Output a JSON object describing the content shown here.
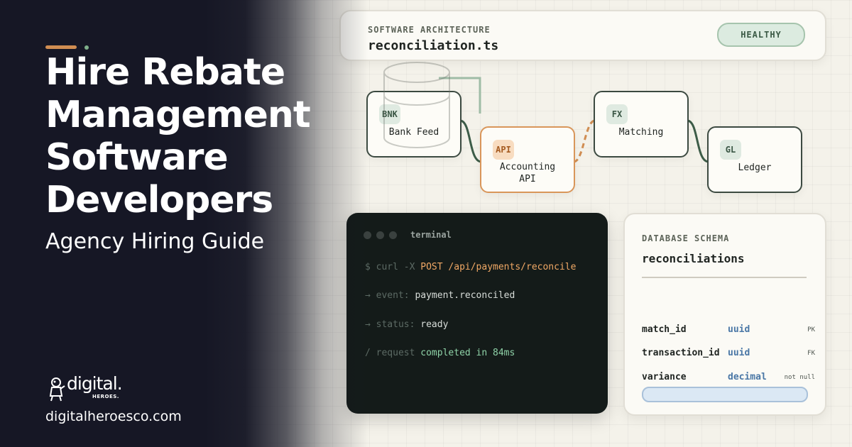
{
  "hero": {
    "headline": [
      "Hire Rebate",
      "Management",
      "Software",
      "Developers"
    ],
    "subtitle": "Agency Hiring Guide",
    "brand_word": "digital.",
    "brand_sub": "HEROES.",
    "site": "digitalheroesco.com"
  },
  "architecture": {
    "label": "SOFTWARE ARCHITECTURE",
    "file": "reconciliation.ts",
    "status": "HEALTHY",
    "nodes": [
      {
        "tag": "BNK",
        "title": "Bank Feed"
      },
      {
        "tag": "API",
        "title": "Accounting\nAPI"
      },
      {
        "tag": "FX",
        "title": "Matching"
      },
      {
        "tag": "GL",
        "title": "Ledger"
      }
    ]
  },
  "terminal": {
    "title": "terminal",
    "prompt": "$",
    "command_word": "curl -X",
    "command_rest": "POST /api/payments/reconcile",
    "lines": [
      {
        "prefix": "→",
        "key": "event:",
        "value": "payment.reconciled"
      },
      {
        "prefix": "→",
        "key": "status:",
        "value": "ready"
      },
      {
        "prefix": "/",
        "key": "request",
        "value": "completed in 84ms"
      }
    ]
  },
  "schema": {
    "label": "DATABASE SCHEMA",
    "table": "reconciliations",
    "fields": [
      {
        "name": "match_id",
        "type": "uuid",
        "flag": "PK"
      },
      {
        "name": "transaction_id",
        "type": "uuid",
        "flag": "FK"
      },
      {
        "name": "variance",
        "type": "decimal",
        "flag": "not null"
      }
    ]
  },
  "colors": {
    "dark_panel": "#161725",
    "accent_orange": "#d08d52",
    "node_border": "#3c4a41",
    "connector_green": "#3d5c48",
    "type_blue": "#4a77a6"
  },
  "icons": [
    "digital-heroes-mascot-icon"
  ]
}
